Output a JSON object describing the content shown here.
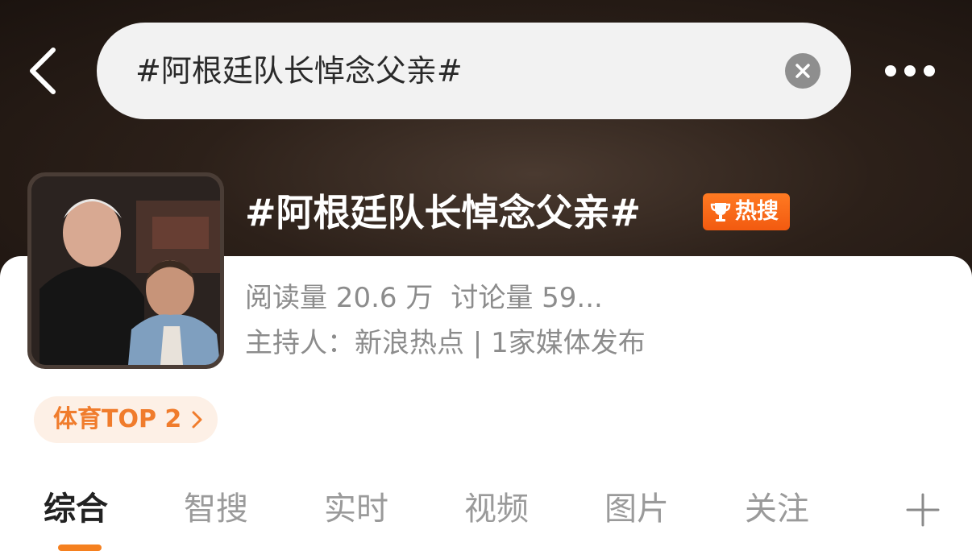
{
  "search": {
    "query": "#阿根廷队长悼念父亲#"
  },
  "topic": {
    "title": "#阿根廷队长悼念父亲#",
    "badge": "热搜",
    "reads": "阅读量 20.6 万",
    "discussions": "讨论量 59...",
    "host": "主持人：新浪热点 | 1家媒体发布",
    "rank": "体育TOP 2"
  },
  "tabs": [
    {
      "label": "综合",
      "active": true
    },
    {
      "label": "智搜"
    },
    {
      "label": "实时"
    },
    {
      "label": "视频"
    },
    {
      "label": "图片"
    },
    {
      "label": "关注"
    }
  ],
  "colors": {
    "accent": "#f5801f",
    "hot_badge": "#f25a10"
  },
  "icons": [
    "back-icon",
    "clear-icon",
    "more-icon",
    "trophy-icon",
    "chevron-right-icon",
    "plus-icon"
  ]
}
